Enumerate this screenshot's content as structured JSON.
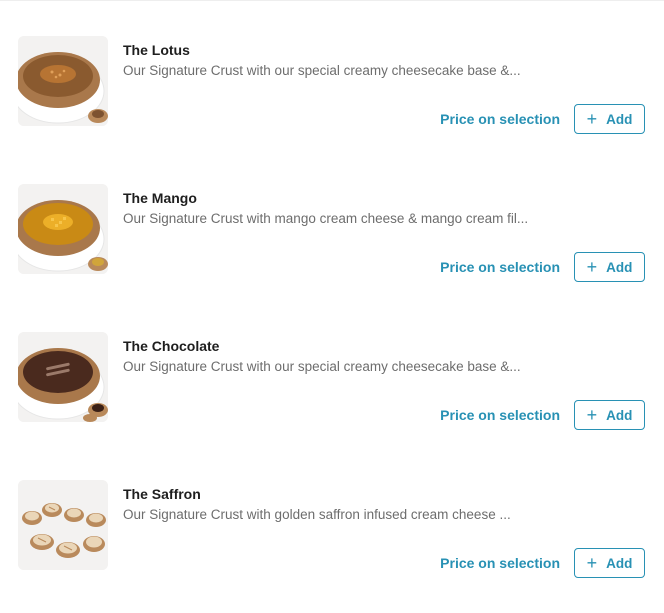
{
  "products": [
    {
      "name": "The Lotus",
      "description": "Our Signature Crust with our special creamy cheesecake base &...",
      "price_label": "Price on selection",
      "add_label": "Add",
      "image_icon": "cheesecake-lotus-image",
      "filling_color": "#8a5a2f"
    },
    {
      "name": "The Mango",
      "description": "Our Signature Crust with mango cream cheese & mango cream fil...",
      "price_label": "Price on selection",
      "add_label": "Add",
      "image_icon": "cheesecake-mango-image",
      "filling_color": "#c98a15"
    },
    {
      "name": "The Chocolate",
      "description": "Our Signature Crust with our special creamy cheesecake base &...",
      "price_label": "Price on selection",
      "add_label": "Add",
      "image_icon": "cheesecake-chocolate-image",
      "filling_color": "#4a2a1e"
    },
    {
      "name": "The Saffron",
      "description": "Our Signature Crust with golden saffron infused cream cheese ...",
      "price_label": "Price on selection",
      "add_label": "Add",
      "image_icon": "saffron-tarts-image",
      "filling_color": "#e9d3b4"
    }
  ],
  "colors": {
    "accent": "#2891b4",
    "title_text": "#1e1e1e",
    "description_text": "#6d6d6d"
  },
  "icons": {
    "add": "plus-icon"
  }
}
